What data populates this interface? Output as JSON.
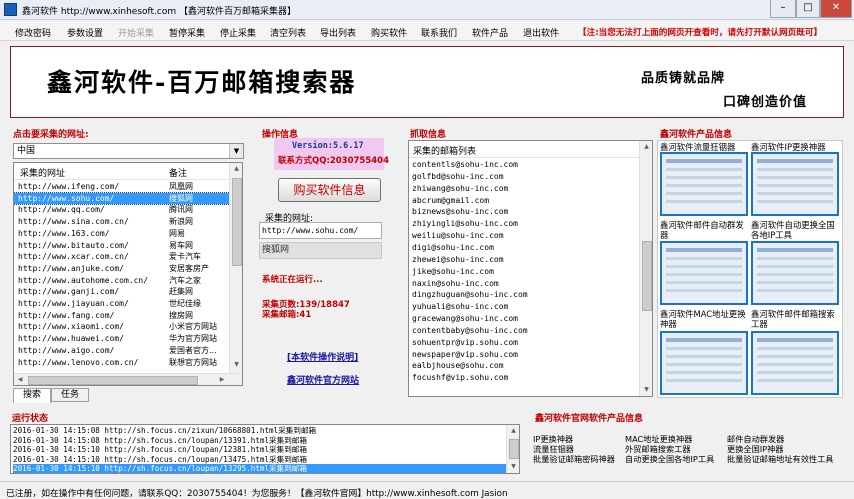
{
  "window": {
    "title": "鑫河软件 http://www.xinhesoft.com 【鑫河软件百万邮箱采集器】"
  },
  "menu": [
    {
      "label": "修改密码",
      "disabled": false
    },
    {
      "label": "参数设置",
      "disabled": false
    },
    {
      "label": "开始采集",
      "disabled": true
    },
    {
      "label": "暂停采集",
      "disabled": false
    },
    {
      "label": "停止采集",
      "disabled": false
    },
    {
      "label": "清空列表",
      "disabled": false
    },
    {
      "label": "导出列表",
      "disabled": false
    },
    {
      "label": "购买软件",
      "disabled": false
    },
    {
      "label": "联系我们",
      "disabled": false
    },
    {
      "label": "软件产品",
      "disabled": false
    },
    {
      "label": "退出软件",
      "disabled": false
    }
  ],
  "menu_notice": "【注:当您无法打上面的网页开查看时，请先打开默认网页既可】",
  "banner": {
    "title": "鑫河软件-百万邮箱搜索器",
    "slogan1": "品质铸就品牌",
    "slogan2": "口碑创造价值"
  },
  "left": {
    "label": "点击要采集的网址:",
    "region": "中国",
    "columns": [
      "采集的网址",
      "备注"
    ],
    "rows": [
      {
        "url": "http://www.ifeng.com/",
        "note": "凤凰网"
      },
      {
        "url": "http://www.sohu.com/",
        "note": "搜狐网"
      },
      {
        "url": "http://www.qq.com/",
        "note": "腾讯网"
      },
      {
        "url": "http://www.sina.com.cn/",
        "note": "新浪网"
      },
      {
        "url": "http://www.163.com/",
        "note": "网易"
      },
      {
        "url": "http://www.bitauto.com/",
        "note": "易车网"
      },
      {
        "url": "http://www.xcar.com.cn/",
        "note": "爱卡汽车"
      },
      {
        "url": "http://www.anjuke.com/",
        "note": "安居客房产"
      },
      {
        "url": "http://www.autohome.com.cn/",
        "note": "汽车之家"
      },
      {
        "url": "http://www.ganji.com/",
        "note": "赶集网"
      },
      {
        "url": "http://www.jiayuan.com/",
        "note": "世纪佳缘"
      },
      {
        "url": "http://www.fang.com/",
        "note": "搜房网"
      },
      {
        "url": "http://www.xiaomi.com/",
        "note": "小米官方网站"
      },
      {
        "url": "http://www.huawei.com/",
        "note": "华为官方网站"
      },
      {
        "url": "http://www.aigo.com/",
        "note": "爱国者官方..."
      },
      {
        "url": "http://www.lenovo.com.cn/",
        "note": "联想官方网站"
      }
    ],
    "selected_row": 1,
    "tabs": [
      "搜索",
      "任务"
    ]
  },
  "middle": {
    "label": "操作信息",
    "version": "Version:5.6.17",
    "contact": "联系方式QQ:2030755404",
    "buy_button": "购买软件信息",
    "url_label": "采集的网址:",
    "url_value": "http://www.sohu.com/",
    "site_name": "搜狐网",
    "running": "系统正在运行...",
    "pages": "采集页数:139/18847",
    "emails": "采集邮箱:41",
    "link_help": "[本软件操作说明]",
    "link_site": "鑫河软件官方网站"
  },
  "emails_panel": {
    "label": "抓取信息",
    "header": "采集的邮箱列表",
    "items": [
      "contentls@sohu-inc.com",
      "golfbd@sohu-inc.com",
      "zhiwang@sohu-inc.com",
      "abcrum@gmail.com",
      "biznews@sohu-inc.com",
      "zhiyingli@sohu-inc.com",
      "weiliu@sohu-inc.com",
      "digi@sohu-inc.com",
      "zhewei@sohu-inc.com",
      "jike@sohu-inc.com",
      "naxin@sohu-inc.com",
      "dingzhuguan@sohu-inc.com",
      "yuhuali@sohu-inc.com",
      "gracewang@sohu-inc.com",
      "contentbaby@sohu-inc.com",
      "sohuentpr@vip.sohu.com",
      "newspaper@vip.sohu.com",
      "ealbjhouse@sohu.com",
      "focushf@vip.sohu.com"
    ]
  },
  "products": {
    "label": "鑫河软件产品信息",
    "cards": [
      "鑫河软件流量狂铟器",
      "鑫河软件IP更换神器",
      "鑫河软件邮件自动群发器",
      "鑫河软件自动更换全国各地IP工具",
      "鑫河软件MAC地址更换神器",
      "鑫河软件邮件邮箱搜索工器"
    ]
  },
  "log": {
    "label": "运行状态",
    "rows": [
      "2016-01-30 14:15:08 http://sh.focus.cn/zixun/10668801.html采集到邮箱",
      "2016-01-30 14:15:08 http://sh.focus.cn/loupan/13391.html采集到邮箱",
      "2016-01-30 14:15:10 http://sh.focus.cn/loupan/12381.html采集到邮箱",
      "2016-01-30 14:15:10 http://sh.focus.cn/loupan/13475.html采集到邮箱",
      "2016-01-30 14:15:10 http://sh.focus.cn/loupan/13295.html采集到邮箱"
    ],
    "selected_row": 4
  },
  "official": {
    "label": "鑫河软件官网软件产品信息",
    "links": [
      "IP更换神器",
      "MAC地址更换神器",
      "邮件自动群发器",
      "流量狂铟器",
      "外贸邮箱搜索工器",
      "更换全国IP神器",
      "批量验证邮箱密码神器",
      "自动更换全国各地IP工具",
      "批量验证邮箱地址有效性工具"
    ]
  },
  "status": "已注册，如在操作中有任何问题，请联系QQ：2030755404！为您服务！【鑫河软件官网】http://www.xinhesoft.com Jasion"
}
